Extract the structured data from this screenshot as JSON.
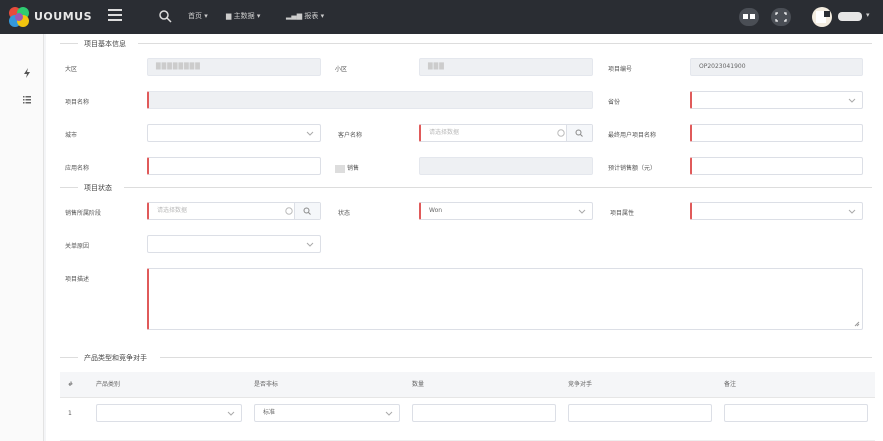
{
  "topbar": {
    "brand": "UOUMUS",
    "menus": [
      {
        "label": "首页"
      },
      {
        "label": "主数据"
      },
      {
        "label": "报表"
      }
    ]
  },
  "sections": {
    "basic": "项目基本信息",
    "status": "项目状态",
    "products": "产品类型和竞争对手"
  },
  "fields": {
    "region_label": "大区",
    "region_value": "████████",
    "subregion_label": "小区",
    "subregion_value": "███",
    "project_no_label": "项目编号",
    "project_no_value": "OP2023041900",
    "project_name_label": "项目名称",
    "province_label": "省份",
    "city_label": "城市",
    "customer_label": "客户名称",
    "customer_placeholder": "请选择数据",
    "final_user_label": "最终用户项目名称",
    "app_name_label": "应用名称",
    "sales_label": "销售",
    "est_amount_label": "预计销售额（元）",
    "stage_label": "销售所属阶段",
    "stage_placeholder": "请选择数据",
    "status_label": "状态",
    "status_value": "Won",
    "attr_label": "项目属性",
    "close_reason_label": "关单原因",
    "desc_label": "项目描述"
  },
  "table": {
    "headers": [
      "#",
      "产品类别",
      "是否非标",
      "数量",
      "竞争对手",
      "备注"
    ],
    "rows": [
      {
        "index": "1",
        "nonstandard": "标准"
      }
    ]
  }
}
